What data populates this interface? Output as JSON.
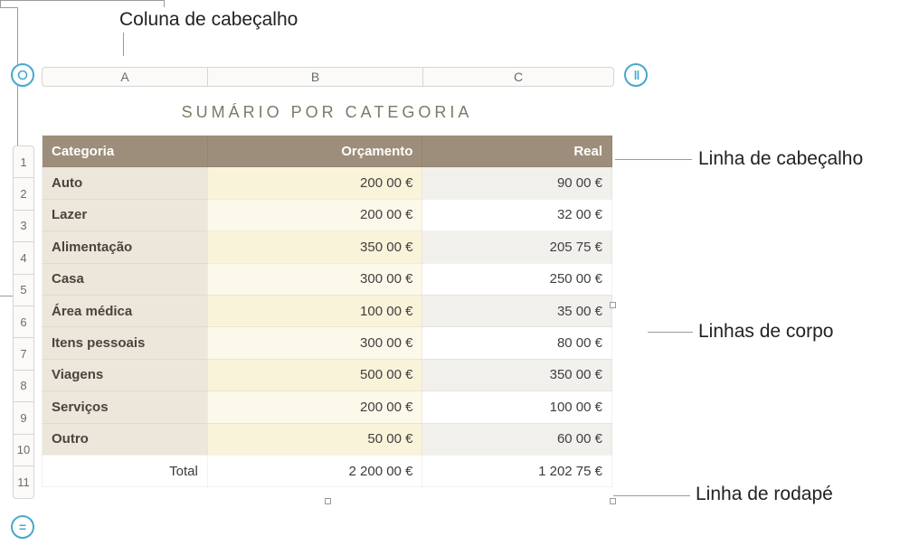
{
  "annotations": {
    "header_column": "Coluna de cabeçalho",
    "header_row": "Linha de cabeçalho",
    "body_rows": "Linhas de corpo",
    "footer_row": "Linha de rodapé"
  },
  "column_letters": [
    "A",
    "B",
    "C"
  ],
  "row_numbers": [
    "1",
    "2",
    "3",
    "4",
    "5",
    "6",
    "7",
    "8",
    "9",
    "10",
    "11"
  ],
  "table": {
    "title": "SUMÁRIO POR CATEGORIA",
    "headers": {
      "cat": "Categoria",
      "orcamento": "Orçamento",
      "real": "Real"
    },
    "rows": [
      {
        "cat": "Auto",
        "orc": "200 00 €",
        "real": "90 00 €"
      },
      {
        "cat": "Lazer",
        "orc": "200 00 €",
        "real": "32 00 €"
      },
      {
        "cat": "Alimentação",
        "orc": "350 00 €",
        "real": "205 75 €"
      },
      {
        "cat": "Casa",
        "orc": "300 00 €",
        "real": "250 00 €"
      },
      {
        "cat": "Área médica",
        "orc": "100 00 €",
        "real": "35 00 €"
      },
      {
        "cat": "Itens pessoais",
        "orc": "300 00 €",
        "real": "80 00 €"
      },
      {
        "cat": "Viagens",
        "orc": "500 00 €",
        "real": "350 00 €"
      },
      {
        "cat": "Serviços",
        "orc": "200 00 €",
        "real": "100 00 €"
      },
      {
        "cat": "Outro",
        "orc": "50 00 €",
        "real": "60 00 €"
      }
    ],
    "footer": {
      "label": "Total",
      "orc": "2 200 00 €",
      "real": "1 202 75 €"
    }
  },
  "icons": {
    "corner": "circle-outline",
    "col_handle": "||",
    "row_handle": "="
  },
  "chart_data": {
    "type": "table",
    "title": "SUMÁRIO POR CATEGORIA",
    "columns": [
      "Categoria",
      "Orçamento",
      "Real"
    ],
    "categories": [
      "Auto",
      "Lazer",
      "Alimentação",
      "Casa",
      "Área médica",
      "Itens pessoais",
      "Viagens",
      "Serviços",
      "Outro"
    ],
    "series": [
      {
        "name": "Orçamento",
        "values": [
          200.0,
          200.0,
          350.0,
          300.0,
          100.0,
          300.0,
          500.0,
          200.0,
          50.0
        ]
      },
      {
        "name": "Real",
        "values": [
          90.0,
          32.0,
          205.75,
          250.0,
          35.0,
          80.0,
          350.0,
          100.0,
          60.0
        ]
      }
    ],
    "totals": {
      "Orçamento": 2200.0,
      "Real": 1202.75
    },
    "currency": "€"
  }
}
